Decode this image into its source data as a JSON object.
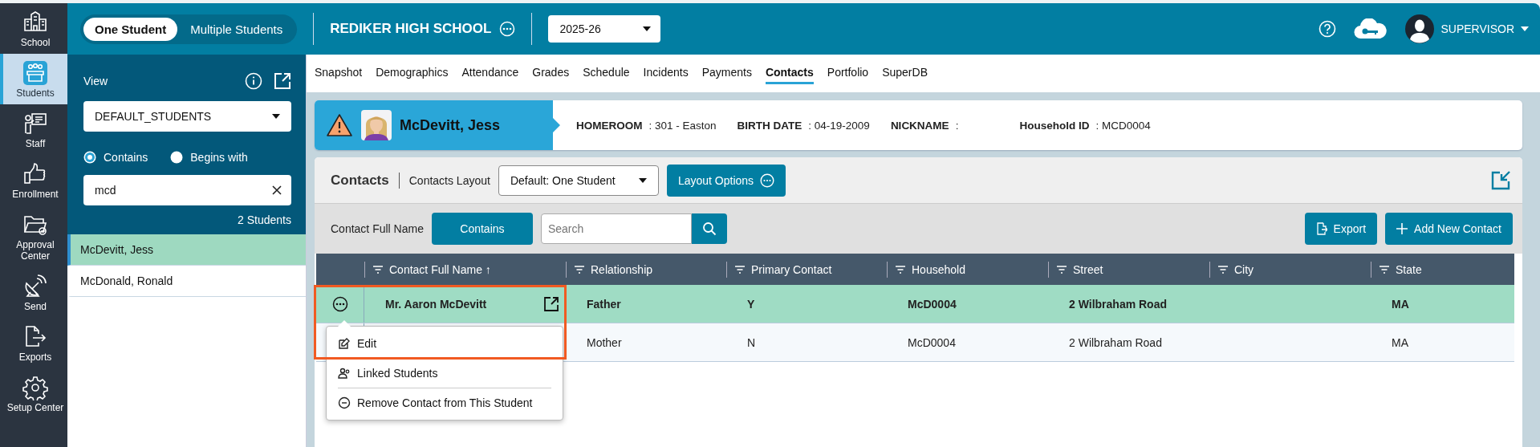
{
  "nav_rail": [
    {
      "label": "School",
      "selected": false
    },
    {
      "label": "Students",
      "selected": true
    },
    {
      "label": "Staff",
      "selected": false
    },
    {
      "label": "Enrollment",
      "selected": false
    },
    {
      "label": "Approval Center",
      "selected": false
    },
    {
      "label": "Send",
      "selected": false
    },
    {
      "label": "Exports",
      "selected": false
    },
    {
      "label": "Setup Center",
      "selected": false
    }
  ],
  "top_bar": {
    "modes": [
      {
        "label": "One Student",
        "selected": true
      },
      {
        "label": "Multiple Students",
        "selected": false
      }
    ],
    "school": "REDIKER HIGH SCHOOL",
    "year": "2025-26",
    "user": "SUPERVISOR"
  },
  "student_panel": {
    "view_label": "View",
    "view": "DEFAULT_STUDENTS",
    "match_options": [
      {
        "label": "Contains",
        "selected": true
      },
      {
        "label": "Begins with",
        "selected": false
      }
    ],
    "search": "mcd",
    "count": "2 Students",
    "students": [
      {
        "name": "McDevitt, Jess",
        "selected": true
      },
      {
        "name": "McDonald, Ronald",
        "selected": false
      }
    ]
  },
  "tabs": [
    {
      "label": "Snapshot",
      "selected": false
    },
    {
      "label": "Demographics",
      "selected": false
    },
    {
      "label": "Attendance",
      "selected": false
    },
    {
      "label": "Grades",
      "selected": false
    },
    {
      "label": "Schedule",
      "selected": false
    },
    {
      "label": "Incidents",
      "selected": false
    },
    {
      "label": "Payments",
      "selected": false
    },
    {
      "label": "Contacts",
      "selected": true
    },
    {
      "label": "Portfolio",
      "selected": false
    },
    {
      "label": "SuperDB",
      "selected": false
    }
  ],
  "student": {
    "name": "McDevitt, Jess",
    "alert": true,
    "fields": [
      {
        "label": "HOMEROOM",
        "value": ": 301 - Easton"
      },
      {
        "label": "BIRTH DATE",
        "value": ": 04-19-2009"
      },
      {
        "label": "NICKNAME",
        "value": ":"
      },
      {
        "label": "Household ID",
        "value": ": MCD0004"
      }
    ]
  },
  "contacts": {
    "title": "Contacts",
    "layout_label": "Contacts Layout",
    "layout": "Default: One Student",
    "layout_button": "Layout Options",
    "filter_label": "Contact Full Name",
    "filter_mode": "Contains",
    "search_placeholder": "Search",
    "export_button": "Export",
    "add_button": "Add New Contact",
    "columns": [
      "Contact Full Name ↑",
      "Relationship",
      "Primary Contact",
      "Household",
      "Street",
      "City",
      "State"
    ],
    "rows": [
      {
        "selected": true,
        "name": "Mr. Aaron McDevitt",
        "relationship": "Father",
        "primary": "Y",
        "household": "McD0004",
        "street": "2 Wilbraham Road",
        "state": "MA"
      },
      {
        "selected": false,
        "relationship": "Mother",
        "primary": "N",
        "household": "McD0004",
        "street": "2 Wilbraham Road",
        "state": "MA"
      }
    ],
    "row_menu": [
      {
        "label": "Edit",
        "highlighted": true
      },
      {
        "label": "Linked Students",
        "highlighted": false
      },
      {
        "label": "Remove Contact from This Student",
        "highlighted": false
      }
    ]
  }
}
